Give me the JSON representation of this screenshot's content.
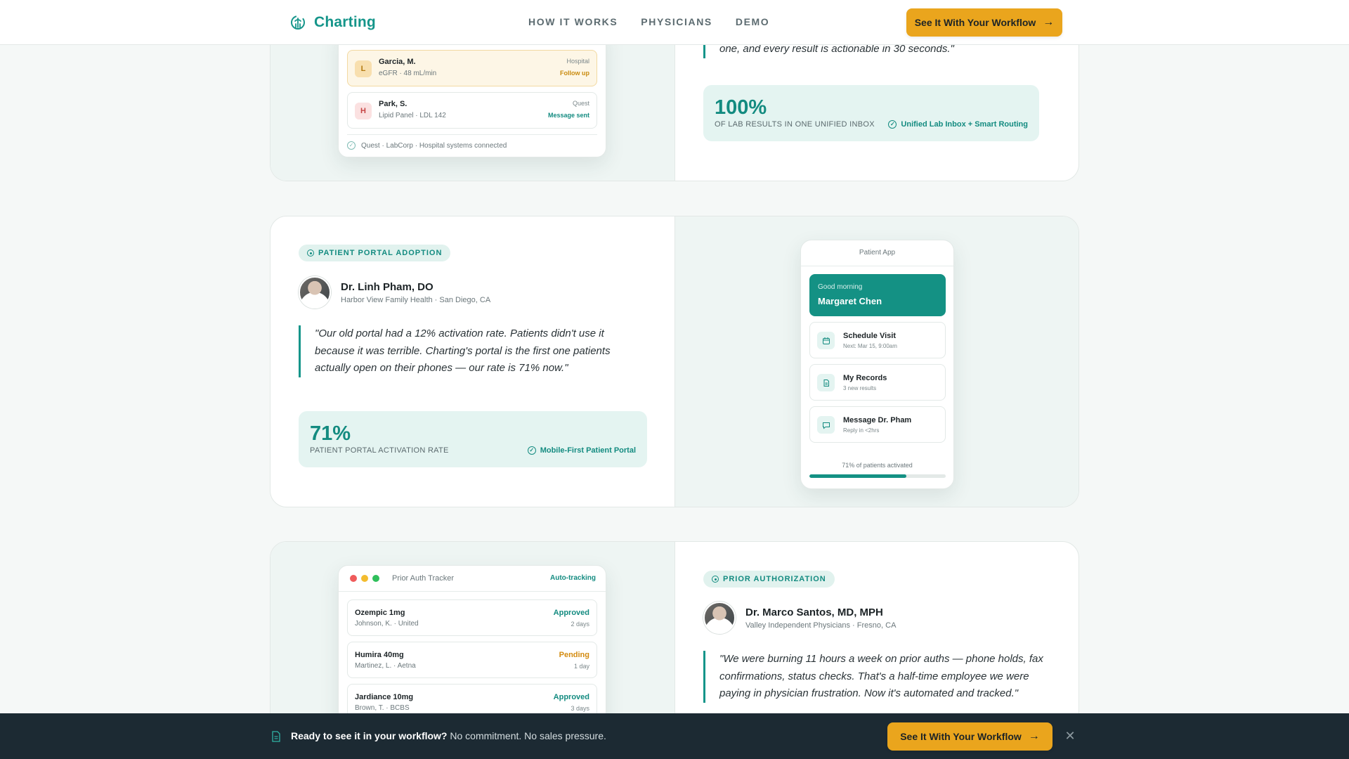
{
  "header": {
    "brand": "Charting",
    "nav": [
      "HOW IT WORKS",
      "PHYSICIANS",
      "DEMO"
    ],
    "cta_label": "See It With Your Workflow"
  },
  "lab_card": {
    "rows": [
      {
        "letter": "L",
        "name": "Garcia, M.",
        "detail": "eGFR · 48 mL/min",
        "source": "Hospital",
        "status": "Follow up"
      },
      {
        "letter": "H",
        "name": "Park, S.",
        "detail": "Lipid Panel · LDL 142",
        "source": "Quest",
        "status": "Message sent"
      }
    ],
    "footer": "Quest · LabCorp · Hospital systems connected",
    "quote_fragment": "one, and every result is actionable in 30 seconds.\"",
    "stat_value": "100%",
    "stat_label": "OF LAB RESULTS IN ONE UNIFIED INBOX",
    "stat_feature": "Unified Lab Inbox + Smart Routing"
  },
  "portal_card": {
    "badge": "PATIENT PORTAL ADOPTION",
    "name": "Dr. Linh Pham, DO",
    "org": "Harbor View Family Health · San Diego, CA",
    "quote": "\"Our old portal had a 12% activation rate. Patients didn't use it because it was terrible. Charting's portal is the first one patients actually open on their phones — our rate is 71% now.\"",
    "stat_value": "71%",
    "stat_label": "PATIENT PORTAL ACTIVATION RATE",
    "stat_feature": "Mobile-First Patient Portal",
    "phone": {
      "title": "Patient App",
      "greeting": "Good morning",
      "patient": "Margaret Chen",
      "actions": [
        {
          "icon": "calendar-icon",
          "title": "Schedule Visit",
          "sub": "Next: Mar 15, 9:00am"
        },
        {
          "icon": "document-icon",
          "title": "My Records",
          "sub": "3 new results"
        },
        {
          "icon": "message-icon",
          "title": "Message Dr. Pham",
          "sub": "Reply in <2hrs"
        }
      ],
      "progress_label": "71% of patients activated",
      "progress_pct": 71
    }
  },
  "auth_card": {
    "badge": "PRIOR AUTHORIZATION",
    "name": "Dr. Marco Santos, MD, MPH",
    "org": "Valley Independent Physicians · Fresno, CA",
    "quote": "\"We were burning 11 hours a week on prior auths — phone holds, fax confirmations, status checks. That's a half-time employee we were paying in physician frustration. Now it's automated and tracked.\"",
    "tracker": {
      "title": "Prior Auth Tracker",
      "auto": "Auto-tracking",
      "rows": [
        {
          "drug": "Ozempic 1mg",
          "patient": "Johnson, K. · United",
          "status": "Approved",
          "days": "2 days"
        },
        {
          "drug": "Humira 40mg",
          "patient": "Martinez, L. · Aetna",
          "status": "Pending",
          "days": "1 day"
        },
        {
          "drug": "Jardiance 10mg",
          "patient": "Brown, T. · BCBS",
          "status": "Approved",
          "days": "3 days"
        }
      ]
    }
  },
  "bottom_bar": {
    "headline": "Ready to see it in your workflow?",
    "sub": " No commitment. No sales pressure.",
    "cta_label": "See It With Your Workflow"
  },
  "colors": {
    "brand": "#15958a",
    "accent": "#eaa51d",
    "approved": "#138b80",
    "pending": "#d38b10",
    "bar": "#1c2a33"
  }
}
